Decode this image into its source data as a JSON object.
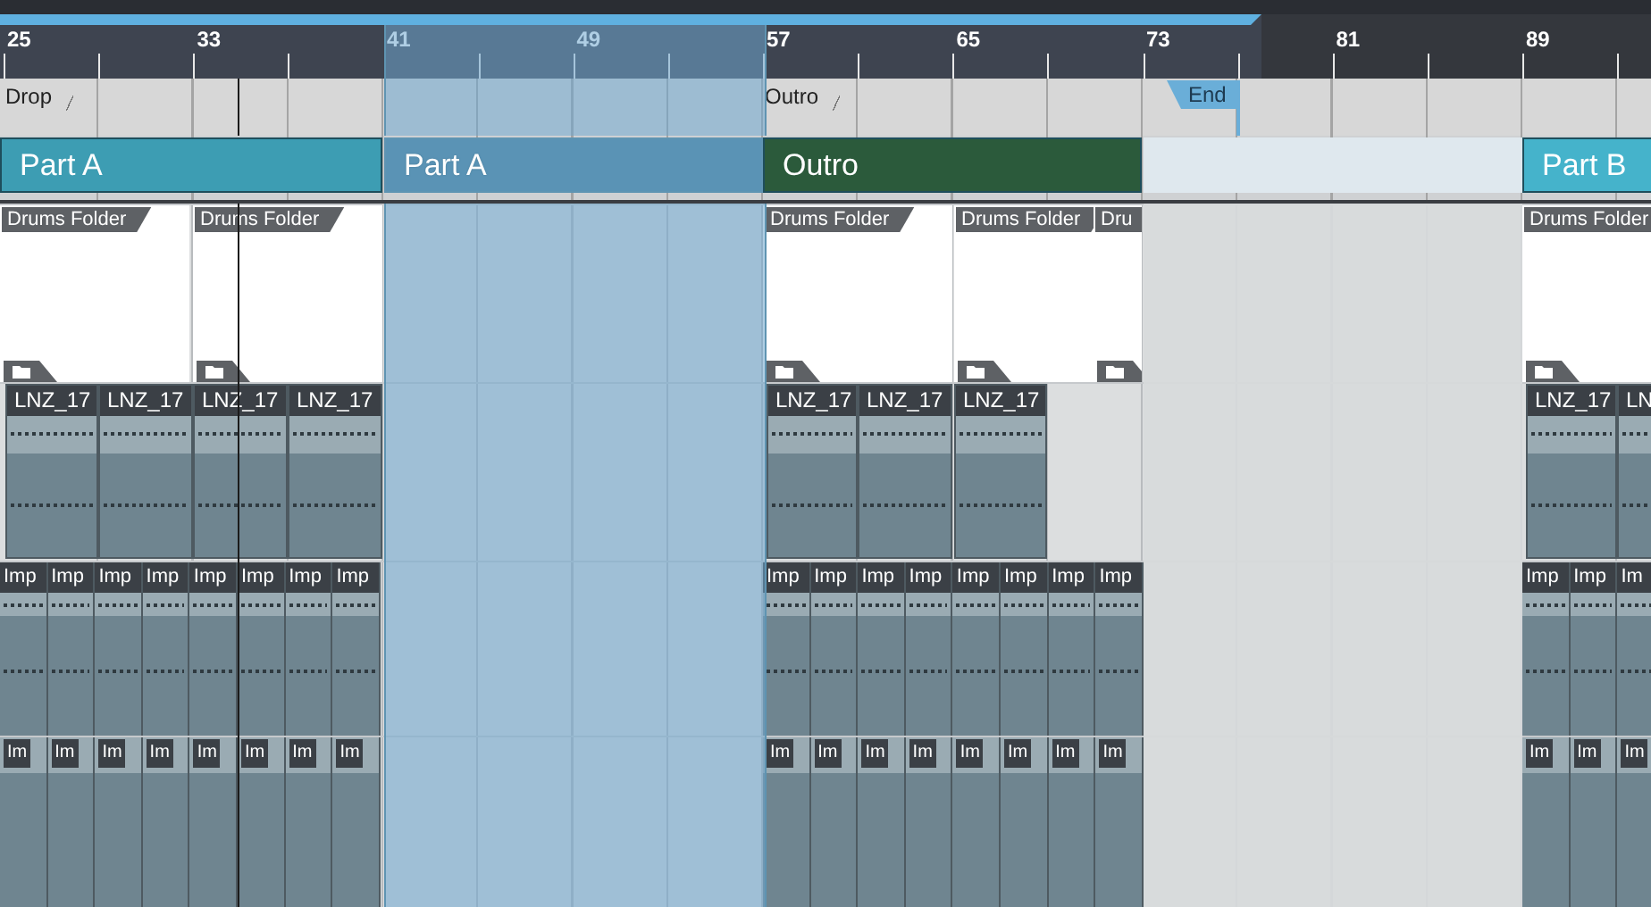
{
  "ruler": {
    "bars": [
      "25",
      "33",
      "41",
      "49",
      "57",
      "65",
      "73",
      "81",
      "89"
    ]
  },
  "markers": [
    {
      "label": "Drop",
      "kind": "marker"
    },
    {
      "label": "Outro",
      "kind": "marker"
    },
    {
      "label": "End",
      "kind": "end"
    }
  ],
  "arranger": [
    {
      "label": "Part A",
      "color": "#3d9db3",
      "selected": false
    },
    {
      "label": "Part A",
      "color": "#5a93b5",
      "selected": true
    },
    {
      "label": "Outro",
      "color": "#2b5a3b",
      "selected": false
    },
    {
      "label": "Part B",
      "color": "#45b3cb",
      "selected": false
    }
  ],
  "tracks": [
    {
      "kind": "folder",
      "clips": [
        "Drums Folder",
        "Drums Folder",
        "Drums Folder",
        "Drums Folder",
        "Dru",
        "Drums Folder"
      ]
    },
    {
      "kind": "audio",
      "clips": [
        "LNZ_17",
        "LNZ_17",
        "LNZ_17",
        "LNZ_17",
        "LNZ_17",
        "LNZ_17",
        "LNZ_17",
        "LNZ_17",
        "LN"
      ]
    },
    {
      "kind": "slice",
      "clips": [
        "Imp",
        "Imp",
        "Imp",
        "Imp",
        "Imp",
        "Imp",
        "Imp",
        "Imp",
        "Imp",
        "Imp",
        "Imp",
        "Imp",
        "Imp",
        "Imp",
        "Imp",
        "Imp",
        "Imp",
        "Imp",
        "Im"
      ]
    },
    {
      "kind": "hit",
      "clips": [
        "Im",
        "Im",
        "Im",
        "Im",
        "Im",
        "Im",
        "Im",
        "Im",
        "Im",
        "Im",
        "Im",
        "Im",
        "Im",
        "Im",
        "Im",
        "Im",
        "Im",
        "Im",
        "Im"
      ]
    }
  ]
}
